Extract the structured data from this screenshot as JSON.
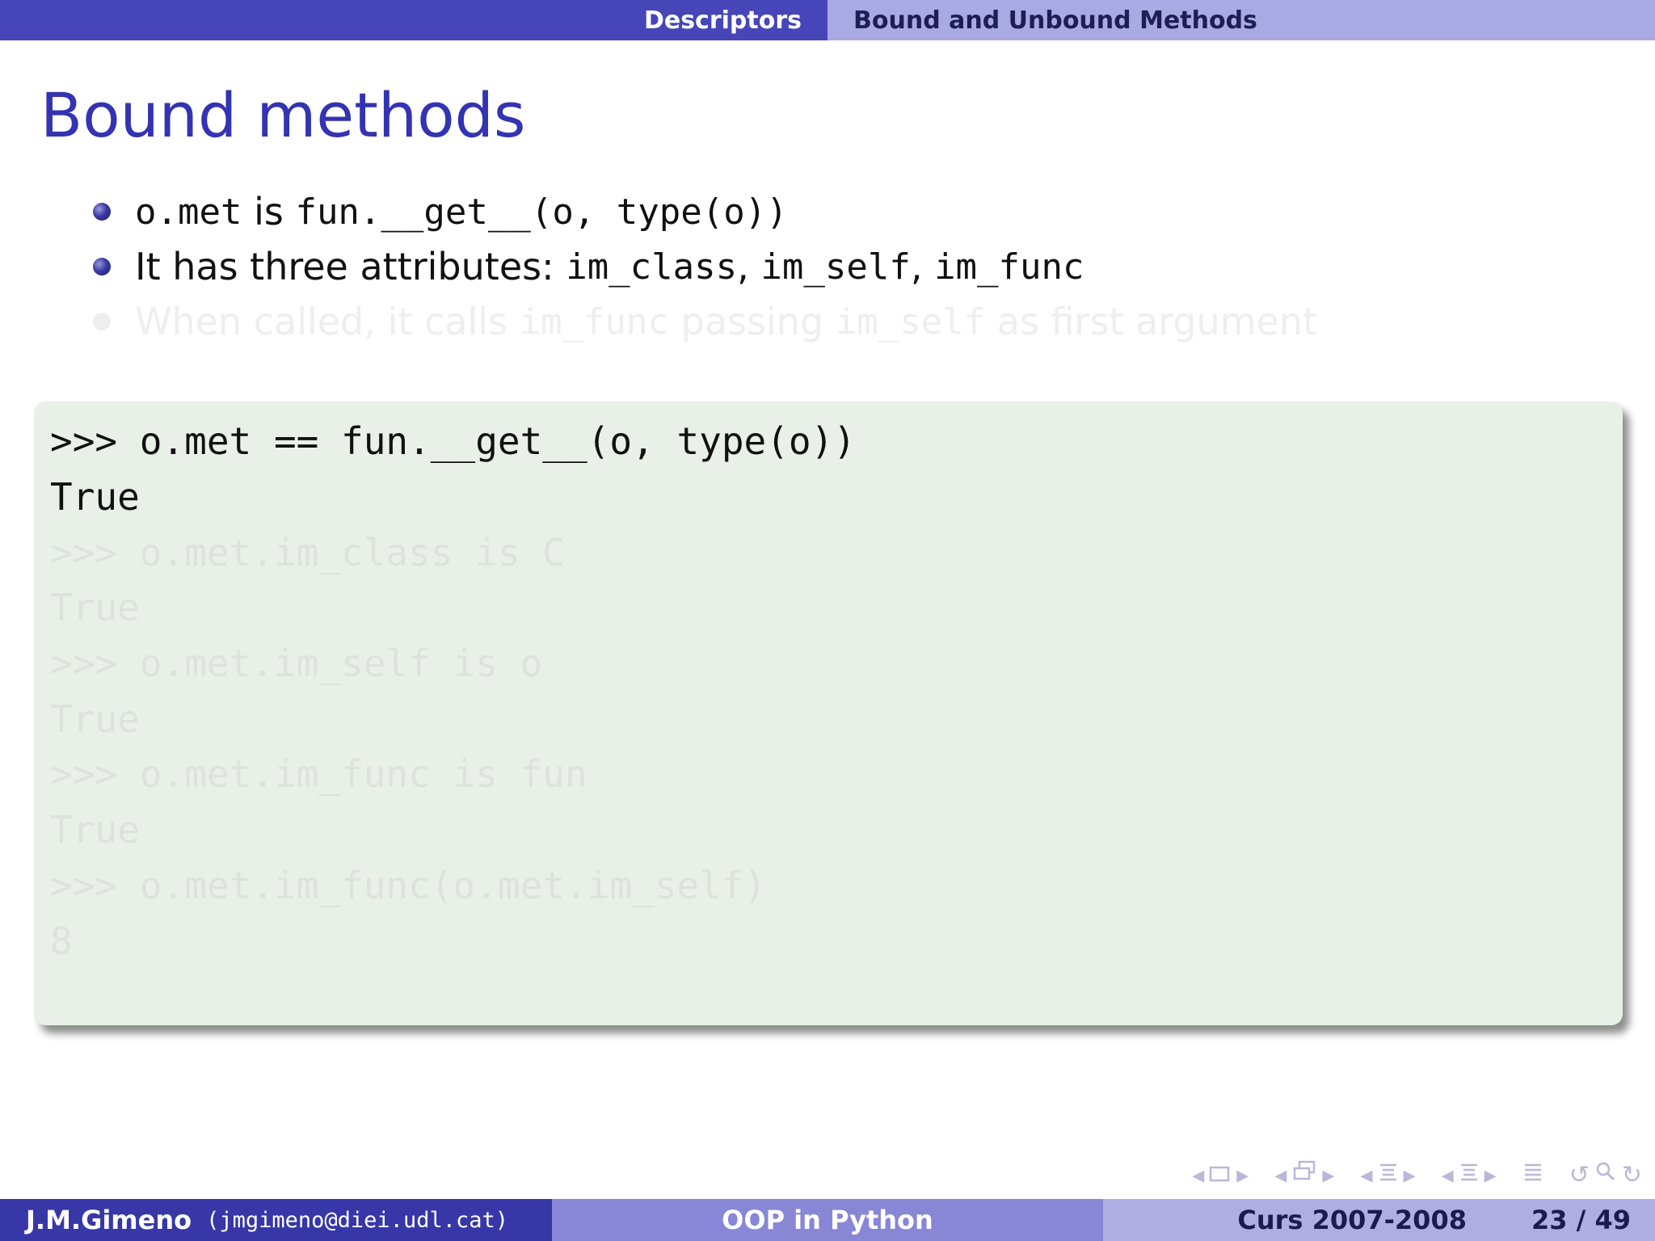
{
  "header": {
    "section": "Descriptors",
    "subsection": "Bound and Unbound Methods"
  },
  "frame": {
    "title": "Bound methods"
  },
  "bullets": {
    "b1": {
      "code1": "o.met",
      "text1": " is ",
      "code2": "fun.__get__(o, type(o))"
    },
    "b2": {
      "text1": "It has three attributes: ",
      "code1": "im_class",
      "sep1": ", ",
      "code2": "im_self",
      "sep2": ", ",
      "code3": "im_func"
    },
    "b3": {
      "text1": "When called, it calls ",
      "code1": "im_func",
      "text2": " passing ",
      "code2": "im_self",
      "text3": " as first argument"
    }
  },
  "code_block": {
    "lines": [
      ">>> o.met == fun.__get__(o, type(o))",
      "True",
      ">>> o.met.im_class is C",
      "True",
      ">>> o.met.im_self is o",
      "True",
      ">>> o.met.im_func is fun",
      "True",
      ">>> o.met.im_func(o.met.im_self)",
      "8"
    ]
  },
  "nav_icons": [
    "frame-prev-icon",
    "frame-icon",
    "frame-next-icon",
    "subsection-prev-icon",
    "subsection-icon",
    "subsection-next-icon",
    "section-prev-icon",
    "section-icon",
    "section-next-icon",
    "subsection-list-prev-icon",
    "subsection-list-icon",
    "subsection-list-next-icon",
    "toc-icon",
    "back-icon",
    "search-icon",
    "forward-icon"
  ],
  "footer": {
    "author": "J.M.Gimeno",
    "email": "(jmgimeno@diei.udl.cat)",
    "title": "OOP in Python",
    "date": "Curs 2007-2008",
    "page": "23 / 49"
  },
  "colors": {
    "header_left": "#4646b8",
    "header_right": "#a9a9e3",
    "title": "#3333b3",
    "code_bg": "#e9f0e8",
    "footer_author": "#3737a8",
    "footer_title": "#8787d6",
    "footer_date": "#aeaee3"
  }
}
